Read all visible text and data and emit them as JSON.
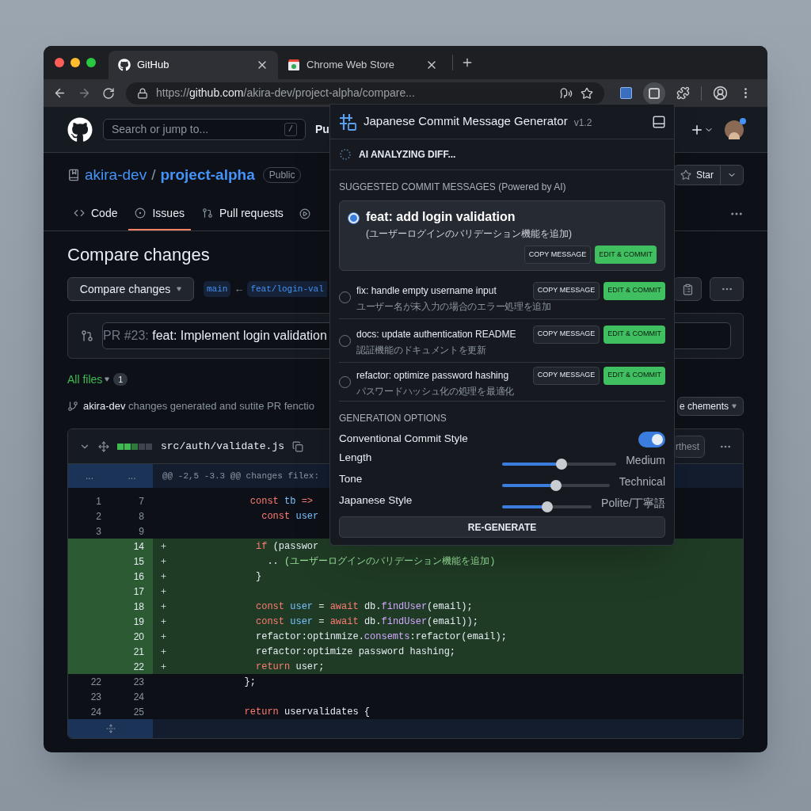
{
  "browser": {
    "tabs": [
      {
        "title": "GitHub",
        "selected": true
      },
      {
        "title": "Chrome Web Store",
        "selected": false
      }
    ],
    "url": {
      "scheme": "https://",
      "host": "github.com",
      "path": "/akira-dev/project-alpha/compare..."
    }
  },
  "github": {
    "search": {
      "placeholder": "Search or jump to...",
      "key": "/"
    },
    "header_link": "Pu",
    "repo": {
      "owner": "akira-dev",
      "separator": "/",
      "name": "project-alpha",
      "visibility": "Public"
    },
    "star": "Star",
    "nav": [
      {
        "label": "Code",
        "selected": false
      },
      {
        "label": "Issues",
        "selected": true
      },
      {
        "label": "Pull requests",
        "selected": false
      }
    ],
    "page_title": "Compare changes",
    "compare_button": "Compare changes",
    "base": "main",
    "arrow": "←",
    "head": "feat/login-val",
    "pr": {
      "prefix": "PR #23:",
      "title": "feat: Implement login validation"
    },
    "files": {
      "label": "All files",
      "count": "1"
    },
    "commit": {
      "author": "akira-dev",
      "text": "changes generated and sutite PR fenctio"
    },
    "comments_button": "e chements",
    "diff": {
      "file": "src/auth/validate.js",
      "view_button": "rthest",
      "hunk": {
        "old": "...",
        "new": "...",
        "header": "@@ -2,5 -3.3 @@ changes filex:"
      },
      "lines": [
        {
          "added": false,
          "old": "1",
          "new": "7",
          "tokens": [
            {
              "kind": "kw",
              "text": "              const "
            },
            {
              "kind": "var",
              "text": "tb "
            },
            {
              "kind": "kw",
              "text": "=>"
            }
          ]
        },
        {
          "added": false,
          "old": "2",
          "new": "8",
          "tokens": [
            {
              "kind": "kw",
              "text": "                const "
            },
            {
              "kind": "var",
              "text": "user"
            }
          ]
        },
        {
          "added": false,
          "old": "3",
          "new": "9"
        },
        {
          "added": true,
          "new": "14",
          "tokens": [
            {
              "kind": "kw",
              "text": "               if "
            },
            {
              "kind": "plain",
              "text": "(passwor"
            }
          ]
        },
        {
          "added": true,
          "new": "15",
          "tokens": [
            {
              "kind": "plain",
              "text": "                 .. "
            },
            {
              "kind": "str",
              "text": "(ユーザーログインのバリデーション機能を追加)"
            }
          ]
        },
        {
          "added": true,
          "new": "16",
          "tokens": [
            {
              "kind": "plain",
              "text": "               }"
            }
          ]
        },
        {
          "added": true,
          "new": "17"
        },
        {
          "added": true,
          "new": "18",
          "tokens": [
            {
              "kind": "kw",
              "text": "               const "
            },
            {
              "kind": "var",
              "text": "user "
            },
            {
              "kind": "plain",
              "text": "= "
            },
            {
              "kind": "kw",
              "text": "await "
            },
            {
              "kind": "plain",
              "text": "db."
            },
            {
              "kind": "fn",
              "text": "findUser"
            },
            {
              "kind": "plain",
              "text": "(email);"
            }
          ]
        },
        {
          "added": true,
          "new": "19",
          "tokens": [
            {
              "kind": "kw",
              "text": "               const "
            },
            {
              "kind": "var",
              "text": "user "
            },
            {
              "kind": "plain",
              "text": "= "
            },
            {
              "kind": "kw",
              "text": "await "
            },
            {
              "kind": "plain",
              "text": "db."
            },
            {
              "kind": "fn",
              "text": "findUser"
            },
            {
              "kind": "plain",
              "text": "(email));"
            }
          ]
        },
        {
          "added": true,
          "new": "20",
          "tokens": [
            {
              "kind": "plain",
              "text": "               refactor:optinmize."
            },
            {
              "kind": "fn",
              "text": "consemts"
            },
            {
              "kind": "plain",
              "text": ":refactor(email);"
            }
          ]
        },
        {
          "added": true,
          "new": "21",
          "tokens": [
            {
              "kind": "plain",
              "text": "               refactor:optimize password hashing;"
            }
          ]
        },
        {
          "added": true,
          "new": "22",
          "tokens": [
            {
              "kind": "kw",
              "text": "               return "
            },
            {
              "kind": "plain",
              "text": "user;"
            }
          ]
        },
        {
          "added": false,
          "old": "22",
          "new": "23",
          "tokens": [
            {
              "kind": "plain",
              "text": "             };"
            }
          ]
        },
        {
          "added": false,
          "old": "23",
          "new": "24"
        },
        {
          "added": false,
          "old": "24",
          "new": "25",
          "tokens": [
            {
              "kind": "kw",
              "text": "             return "
            },
            {
              "kind": "plain",
              "text": "uservalidates {"
            }
          ]
        }
      ]
    }
  },
  "popup": {
    "title": "Japanese Commit Message Generator",
    "version": "v1.2",
    "status": "AI ANALYZING DIFF...",
    "section": "SUGGESTED COMMIT MESSAGES (Powered by AI)",
    "suggestions": [
      {
        "message": "feat: add login validation",
        "translation": "(ユーザーログインのバリデーション機能を追加)",
        "selected": true,
        "copy": "COPY MESSAGE",
        "commit": "EDIT & COMMIT"
      },
      {
        "message": "fix: handle empty username input",
        "translation": "ユーザー名が未入力の場合のエラー処理を追加",
        "selected": false,
        "copy": "COPY MESSAGE",
        "commit": "EDIT & COMMIT"
      },
      {
        "message": "docs: update authentication README",
        "translation": "認証機能のドキュメントを更新",
        "selected": false,
        "copy": "COPY MESSAGE",
        "commit": "EDIT & COMMIT"
      },
      {
        "message": "refactor: optimize password hashing",
        "translation": "パスワードハッシュ化の処理を最適化",
        "selected": false,
        "copy": "COPY MESSAGE",
        "commit": "EDIT & COMMIT"
      }
    ],
    "options_title": "GENERATION OPTIONS",
    "options": [
      {
        "kind": "toggle",
        "label": "Conventional Commit Style",
        "on": true
      },
      {
        "kind": "slider",
        "label": "Length",
        "level": 0.52,
        "value": "Medium"
      },
      {
        "kind": "slider",
        "label": "Tone",
        "level": 0.5,
        "value": "Technical"
      },
      {
        "kind": "slider",
        "label": "Japanese Style",
        "level": 0.5,
        "value": "Polite/丁寧語"
      }
    ],
    "regenerate": "RE-GENERATE"
  }
}
